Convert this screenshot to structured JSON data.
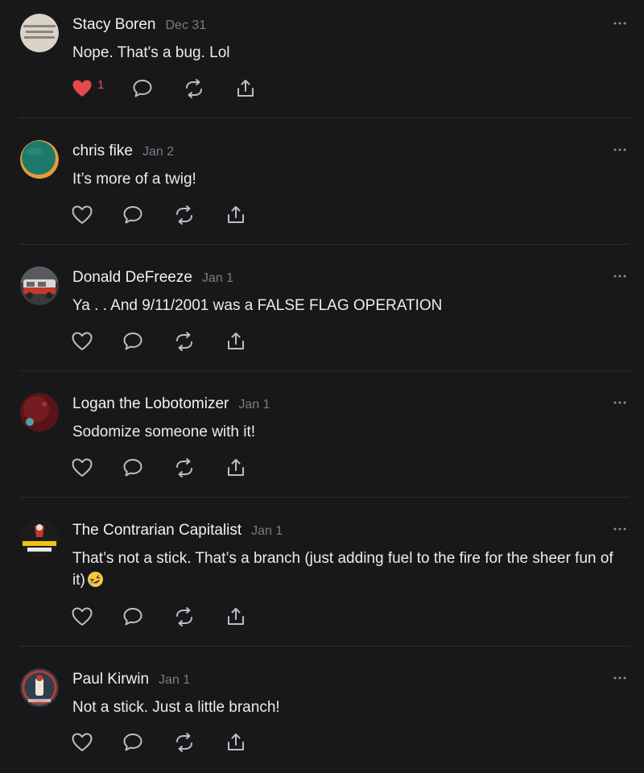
{
  "colors": {
    "background": "#18181a",
    "divider": "#2c2c2f",
    "liked": "#e5484d",
    "muted": "#7c7c82",
    "icon": "#bdbdc2"
  },
  "icons": {
    "like": "heart-icon",
    "reply": "speech-bubble-icon",
    "restack": "restack-icon",
    "share": "share-icon",
    "more": "ellipsis-icon"
  },
  "replies": [
    {
      "author": "Stacy Boren",
      "date": "Dec 31",
      "text": "Nope. That's a bug. Lol",
      "liked": true,
      "like_count": "1",
      "avatar_text": "it takes grace to remain kind in cruel situations"
    },
    {
      "author": "chris fike",
      "date": "Jan 2",
      "text": "It’s more of a twig!",
      "liked": false
    },
    {
      "author": "Donald DeFreeze",
      "date": "Jan 1",
      "text": "Ya . . And 9/11/2001 was a FALSE FLAG OPERATION",
      "liked": false
    },
    {
      "author": "Logan the Lobotomizer",
      "date": "Jan 1",
      "text": "Sodomize someone with it!",
      "liked": false
    },
    {
      "author": "The Contrarian Capitalist",
      "date": "Jan 1",
      "text": "That’s not a stick. That’s a branch (just adding fuel to the fire for the sheer fun of it)",
      "emoji": "rolling-on-floor-laughing-emoji",
      "liked": false,
      "avatar_text": "CONTRARIAN CAPITALIST"
    },
    {
      "author": "Paul Kirwin",
      "date": "Jan 1",
      "text": "Not a stick. Just a little branch!",
      "liked": false,
      "avatar_text": "NEVER"
    }
  ]
}
